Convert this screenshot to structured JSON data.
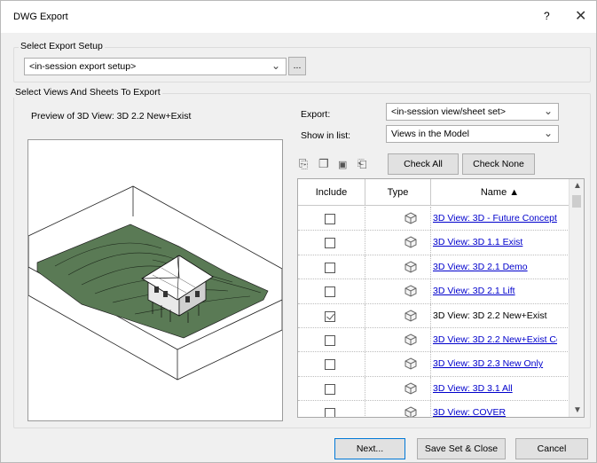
{
  "window": {
    "title": "DWG Export",
    "help": "?",
    "close": "✕"
  },
  "setup_group": {
    "label": "Select Export Setup",
    "combo_value": "<in-session export setup>",
    "more_button": "..."
  },
  "views_group": {
    "label": "Select Views And Sheets To Export",
    "preview_caption": "Preview of 3D View: 3D 2.2 New+Exist",
    "export_label": "Export:",
    "export_value": "<in-session view/sheet set>",
    "show_label": "Show in list:",
    "show_value": "Views in the Model",
    "check_all": "Check All",
    "check_none": "Check None"
  },
  "table": {
    "headers": [
      "Include",
      "Type",
      "Name ▲"
    ],
    "rows": [
      {
        "checked": false,
        "name": "3D View: 3D - Future Concept",
        "link": true
      },
      {
        "checked": false,
        "name": "3D View: 3D 1.1 Exist",
        "link": true
      },
      {
        "checked": false,
        "name": "3D View: 3D 2.1 Demo",
        "link": true
      },
      {
        "checked": false,
        "name": "3D View: 3D 2.1 Lift",
        "link": true
      },
      {
        "checked": true,
        "name": "3D View: 3D 2.2 New+Exist",
        "link": false
      },
      {
        "checked": false,
        "name": "3D View: 3D 2.2 New+Exist Co...",
        "link": true
      },
      {
        "checked": false,
        "name": "3D View: 3D 2.3 New Only",
        "link": true
      },
      {
        "checked": false,
        "name": "3D View: 3D 3.1 All",
        "link": true
      },
      {
        "checked": false,
        "name": "3D View: COVER",
        "link": true
      }
    ]
  },
  "footer": {
    "next": "Next...",
    "save_close": "Save Set & Close",
    "cancel": "Cancel"
  },
  "colors": {
    "terrain": "#5a7a55",
    "link": "#0000cc",
    "accent": "#0078d7"
  }
}
